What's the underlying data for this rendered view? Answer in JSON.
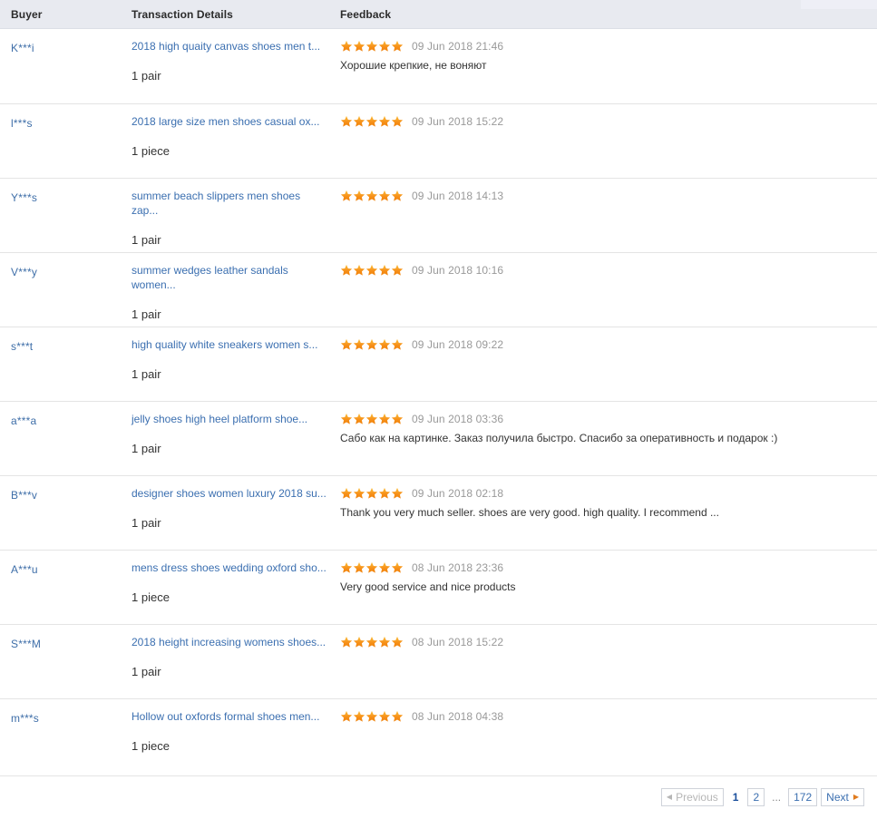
{
  "table": {
    "columns": {
      "buyer": "Buyer",
      "transaction_details": "Transaction Details",
      "feedback": "Feedback"
    },
    "rows": [
      {
        "buyer": "K***i",
        "product": "2018 high quaity canvas shoes men t...",
        "quantity": "1 pair",
        "rating": 5,
        "date": "09 Jun 2018 21:46",
        "comment": "Хорошие крепкие, не воняют"
      },
      {
        "buyer": "l***s",
        "product": "2018 large size men shoes casual ox...",
        "quantity": "1 piece",
        "rating": 5,
        "date": "09 Jun 2018 15:22",
        "comment": ""
      },
      {
        "buyer": "Y***s",
        "product": "summer beach slippers men shoes zap...",
        "quantity": "1 pair",
        "rating": 5,
        "date": "09 Jun 2018 14:13",
        "comment": ""
      },
      {
        "buyer": "V***y",
        "product": "summer wedges leather sandals women...",
        "quantity": "1 pair",
        "rating": 5,
        "date": "09 Jun 2018 10:16",
        "comment": ""
      },
      {
        "buyer": "s***t",
        "product": "high quality white sneakers women s...",
        "quantity": "1 pair",
        "rating": 5,
        "date": "09 Jun 2018 09:22",
        "comment": ""
      },
      {
        "buyer": "a***a",
        "product": "jelly shoes high heel platform shoe...",
        "quantity": "1 pair",
        "rating": 5,
        "date": "09 Jun 2018 03:36",
        "comment": "Сабо как на картинке. Заказ получила быстро. Спасибо за оперативность и подарок :)"
      },
      {
        "buyer": "B***v",
        "product": "designer shoes women luxury 2018 su...",
        "quantity": "1 pair",
        "rating": 5,
        "date": "09 Jun 2018 02:18",
        "comment": "Thank you very much seller. shoes are very good. high quality. I recommend ..."
      },
      {
        "buyer": "A***u",
        "product": "mens dress shoes wedding oxford sho...",
        "quantity": "1 piece",
        "rating": 5,
        "date": "08 Jun 2018 23:36",
        "comment": "Very good service and nice products"
      },
      {
        "buyer": "S***M",
        "product": "2018 height increasing womens shoes...",
        "quantity": "1 pair",
        "rating": 5,
        "date": "08 Jun 2018 15:22",
        "comment": ""
      },
      {
        "buyer": "m***s",
        "product": "Hollow out oxfords formal shoes men...",
        "quantity": "1 piece",
        "rating": 5,
        "date": "08 Jun 2018 04:38",
        "comment": ""
      }
    ]
  },
  "pagination": {
    "previous_label": "Previous",
    "next_label": "Next",
    "ellipsis": "...",
    "pages": [
      "1",
      "2"
    ],
    "last_page": "172",
    "current_page": "1",
    "previous_enabled": false,
    "next_enabled": true
  },
  "colors": {
    "header_bg": "#e8eaf0",
    "link": "#3b6fb0",
    "star": "#f79100",
    "date": "#999999",
    "row_border": "#e4e4e4"
  },
  "icons": {
    "star": "star-icon",
    "prev_arrow": "triangle-left-icon",
    "next_arrow": "triangle-right-icon"
  }
}
